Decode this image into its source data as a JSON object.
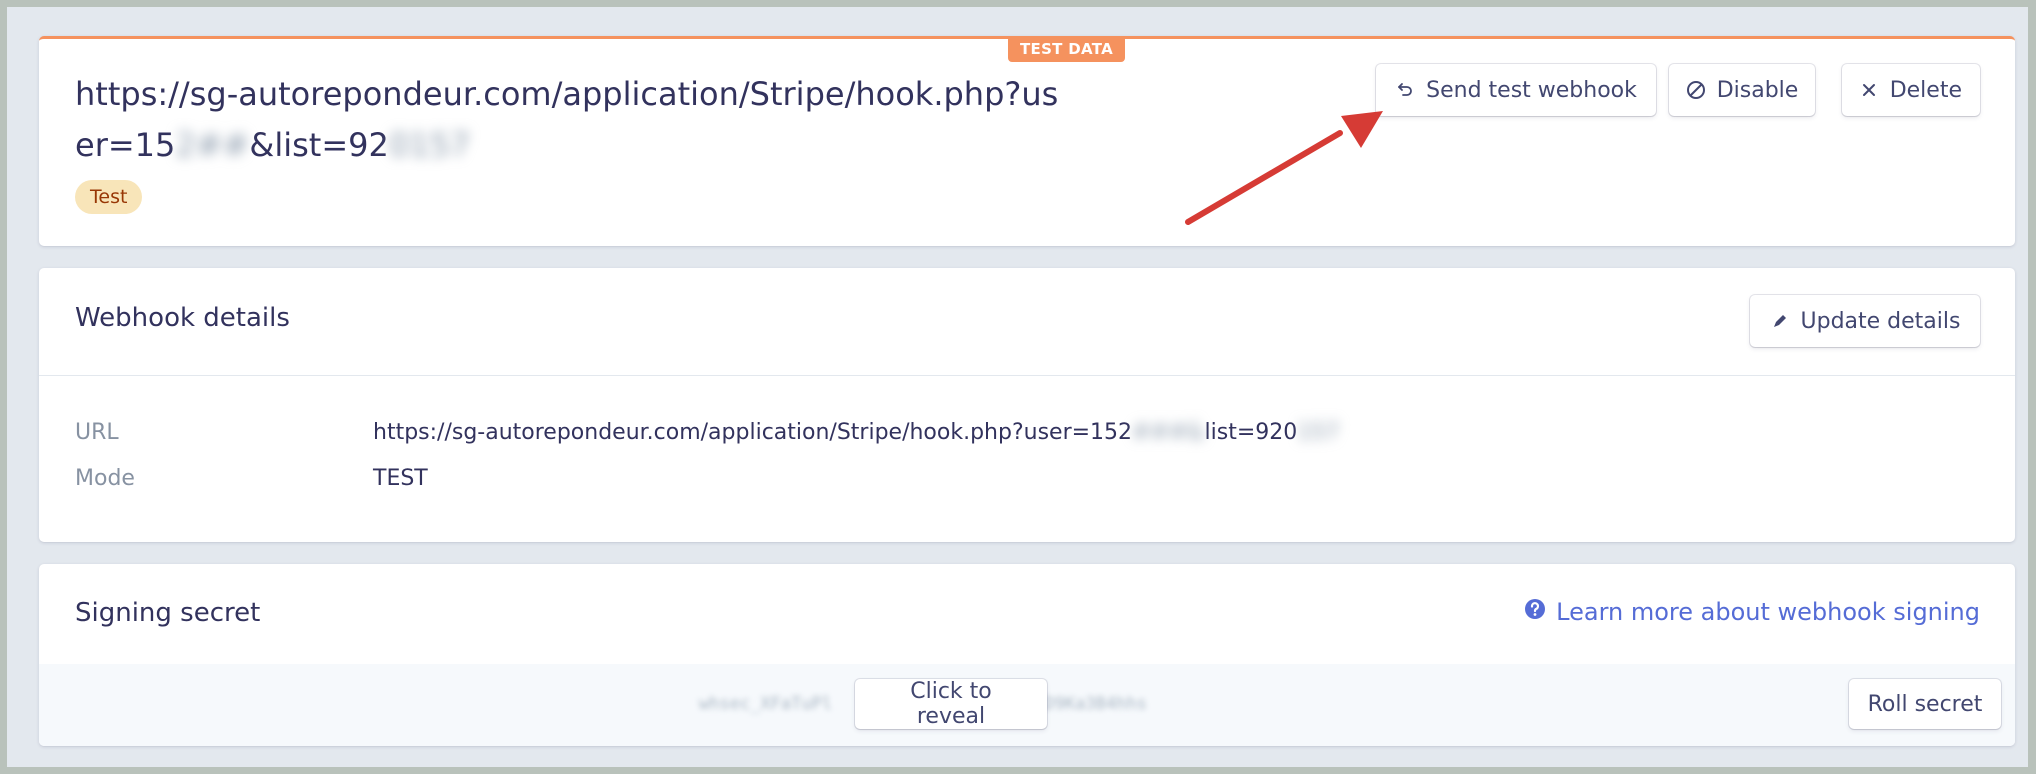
{
  "header": {
    "test_data_tab": "TEST DATA",
    "url_visible_1": "https://sg-autorepondeur.com/application/Stripe/hook.php?",
    "url_visible_2": "user=15",
    "url_redacted_1": "2##",
    "url_visible_3": "&list=92",
    "url_redacted_2": "0157",
    "mode_badge": "Test",
    "buttons": {
      "send_test": "Send test webhook",
      "disable": "Disable",
      "delete": "Delete"
    }
  },
  "details": {
    "title": "Webhook details",
    "update_button": "Update details",
    "rows": [
      {
        "label": "URL",
        "value": "https://sg-autorepondeur.com/application/Stripe/hook.php?user=152",
        "value_redacted": "###&",
        "value_tail": "list=920",
        "value_tail_redacted": "157"
      },
      {
        "label": "Mode",
        "value": "TEST"
      }
    ]
  },
  "secret": {
    "title": "Signing secret",
    "learn_more": "Learn more about webhook signing",
    "masked_value": "whsec_XFaTuPl",
    "masked_value_tail": "LLD9Ka3B4hhs",
    "reveal_button": "Click to reveal",
    "roll_button": "Roll secret"
  },
  "colors": {
    "test_accent": "#f5925e",
    "link": "#556cd6",
    "annotation_arrow": "#d63b35"
  },
  "icons": {
    "send_test": "return-arrow-icon",
    "disable": "circle-slash-icon",
    "delete": "close-icon",
    "update": "pencil-icon",
    "learn_more": "question-circle-icon"
  }
}
